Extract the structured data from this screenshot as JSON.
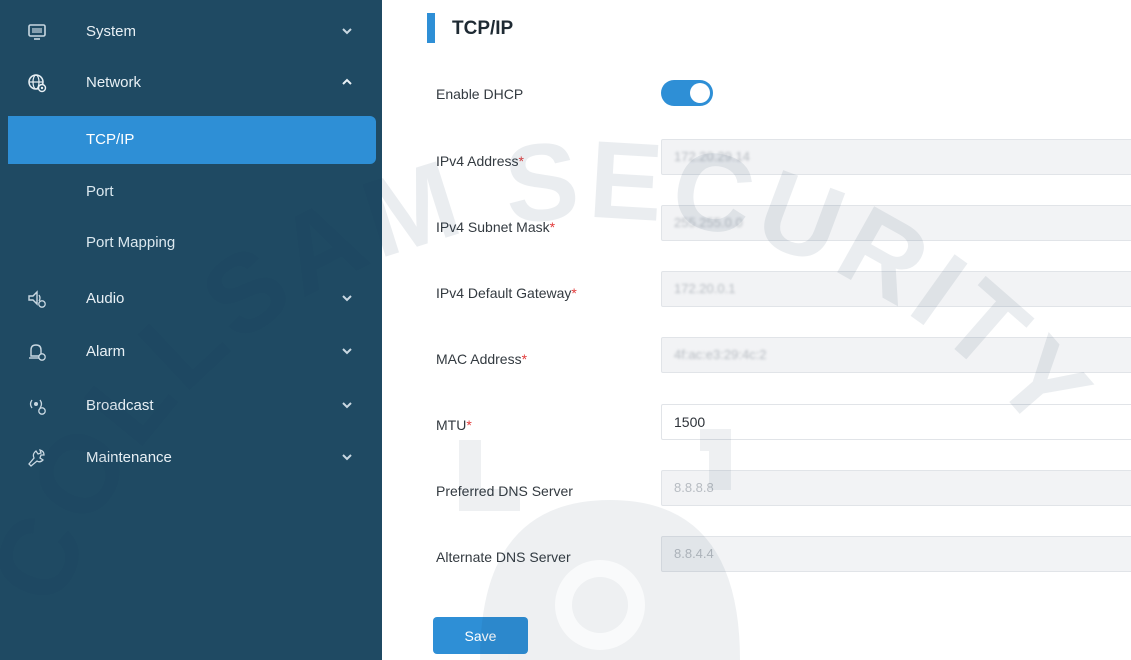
{
  "sidebar": {
    "items": [
      {
        "label": "System",
        "icon": "monitor-icon",
        "expanded": false
      },
      {
        "label": "Network",
        "icon": "globe-settings-icon",
        "expanded": true
      },
      {
        "label": "Audio",
        "icon": "speaker-settings-icon",
        "expanded": false
      },
      {
        "label": "Alarm",
        "icon": "alarm-settings-icon",
        "expanded": false
      },
      {
        "label": "Broadcast",
        "icon": "broadcast-icon",
        "expanded": false
      },
      {
        "label": "Maintenance",
        "icon": "wrench-icon",
        "expanded": false
      }
    ],
    "network_sub": [
      {
        "label": "TCP/IP",
        "active": true
      },
      {
        "label": "Port",
        "active": false
      },
      {
        "label": "Port Mapping",
        "active": false
      }
    ]
  },
  "page": {
    "title": "TCP/IP",
    "accent_color": "#2e8fd6",
    "sidebar_color": "#1f4a63"
  },
  "form": {
    "enable_dhcp": {
      "label": "Enable DHCP",
      "on": true
    },
    "ipv4_address": {
      "label": "IPv4 Address",
      "value": "172.20.29.14"
    },
    "ipv4_subnet_mask": {
      "label": "IPv4 Subnet Mask",
      "value": "255.255.0.0"
    },
    "ipv4_default_gateway": {
      "label": "IPv4 Default Gateway",
      "value": "172.20.0.1"
    },
    "mac_address": {
      "label": "MAC Address",
      "value": "4f:ac:e3:29:4c:2"
    },
    "mtu": {
      "label": "MTU",
      "value": "1500"
    },
    "preferred_dns": {
      "label": "Preferred DNS Server",
      "value": "8.8.8.8"
    },
    "alternate_dns": {
      "label": "Alternate DNS Server",
      "value": "8.8.4.4"
    },
    "required_mark": "*",
    "save_label": "Save"
  },
  "watermark": {
    "text": "COLLSAM SECURITY"
  }
}
